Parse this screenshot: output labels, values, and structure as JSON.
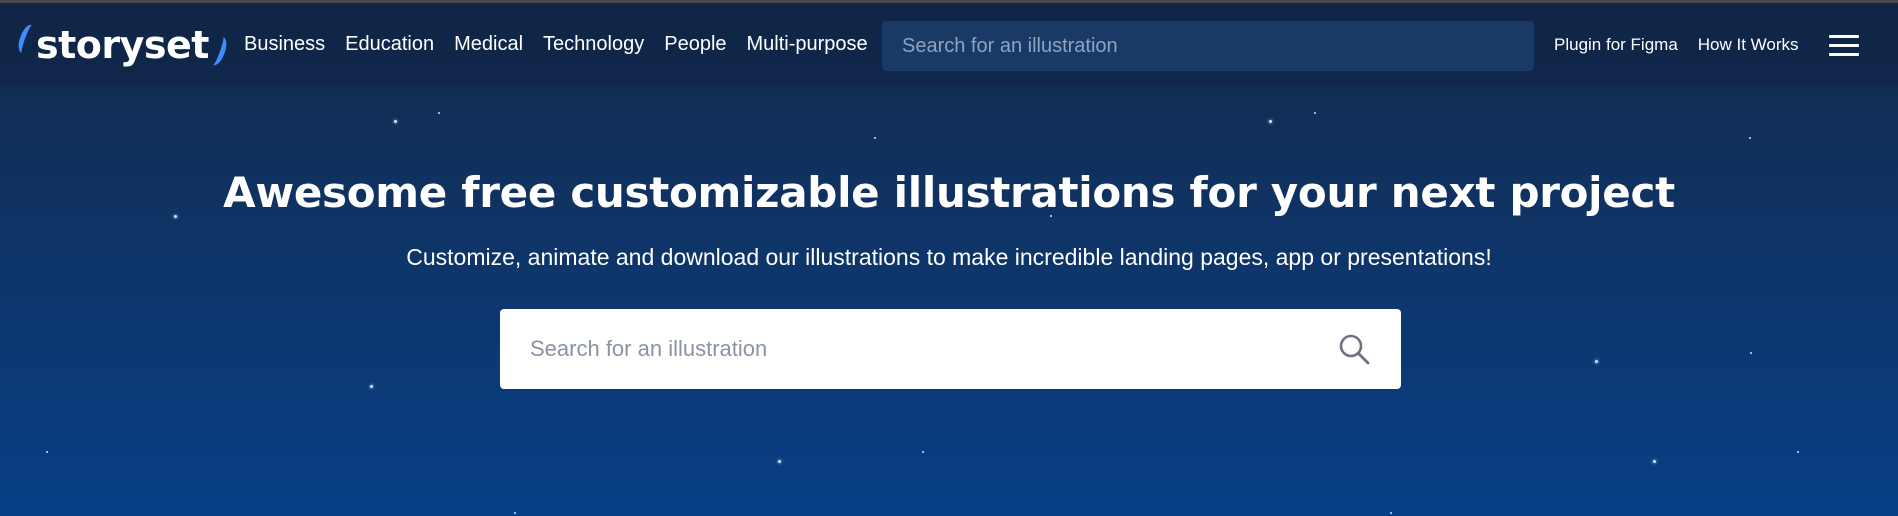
{
  "brand": {
    "logo_text": "storyset"
  },
  "nav": {
    "links": [
      "Business",
      "Education",
      "Medical",
      "Technology",
      "People",
      "Multi-purpose"
    ],
    "search_placeholder": "Search for an illustration",
    "right_links": [
      "Plugin for Figma",
      "How It Works"
    ]
  },
  "hero": {
    "title": "Awesome free customizable illustrations for your next project",
    "subtitle": "Customize, animate and download our illustrations to make incredible landing pages, app or presentations!",
    "search_placeholder": "Search for an illustration"
  },
  "colors": {
    "accent": "#3f8cff",
    "bg_top": "#13294a",
    "bg_bottom": "#073f86"
  }
}
